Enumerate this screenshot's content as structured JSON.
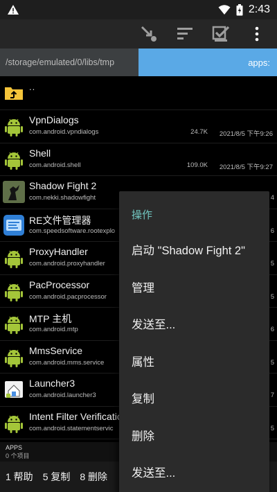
{
  "status_bar": {
    "time": "2:43",
    "icons": [
      "warning-icon",
      "wifi-icon",
      "battery-icon"
    ]
  },
  "toolbar": {
    "buttons": [
      "pointer-sort-icon",
      "filter-list-icon",
      "select-check-icon",
      "more-vert-icon"
    ]
  },
  "pathbar": {
    "path": "/storage/emulated/0/libs/tmp",
    "tab_label": "apps:"
  },
  "list": {
    "parent_label": "..",
    "rows": [
      {
        "name": "VpnDialogs",
        "pkg": "com.android.vpndialogs",
        "size": "24.7K",
        "date": "2021/8/5 下午9:26",
        "icon": "android-icon"
      },
      {
        "name": "Shell",
        "pkg": "com.android.shell",
        "size": "109.0K",
        "date": "2021/8/5 下午9:27",
        "icon": "android-icon"
      },
      {
        "name": "Shadow Fight 2",
        "pkg": "com.nekki.shadowfight",
        "trail": "4",
        "icon": "shadow-fight-icon"
      },
      {
        "name": "RE文件管理器",
        "pkg": "com.speedsoftware.rootexplo",
        "trail": "6",
        "icon": "re-explorer-icon"
      },
      {
        "name": "ProxyHandler",
        "pkg": "com.android.proxyhandler",
        "trail": "5",
        "icon": "android-icon"
      },
      {
        "name": "PacProcessor",
        "pkg": "com.android.pacprocessor",
        "trail": "5",
        "icon": "android-icon"
      },
      {
        "name": "MTP 主机",
        "pkg": "com.android.mtp",
        "trail": "6",
        "icon": "android-icon"
      },
      {
        "name": "MmsService",
        "pkg": "com.android.mms.service",
        "trail": "5",
        "icon": "android-icon"
      },
      {
        "name": "Launcher3",
        "pkg": "com.android.launcher3",
        "trail": "7",
        "icon": "launcher-icon"
      },
      {
        "name": "Intent Filter Verificatio",
        "pkg": "com.android.statementservic",
        "trail": "5",
        "icon": "android-icon"
      }
    ]
  },
  "footer": {
    "title": "APPS",
    "count": "0 个项目"
  },
  "bottom_bar": {
    "keys": [
      "1 帮助",
      "5 复制",
      "8 删除"
    ]
  },
  "context_menu": {
    "header": "操作",
    "items": [
      "启动 \"Shadow Fight 2\"",
      "管理",
      "发送至...",
      "属性",
      "复制",
      "删除",
      "发送至..."
    ]
  },
  "colors": {
    "accent_tab": "#5aa9e6",
    "menu_header": "#72c7c1",
    "android_green": "#a4c639"
  }
}
